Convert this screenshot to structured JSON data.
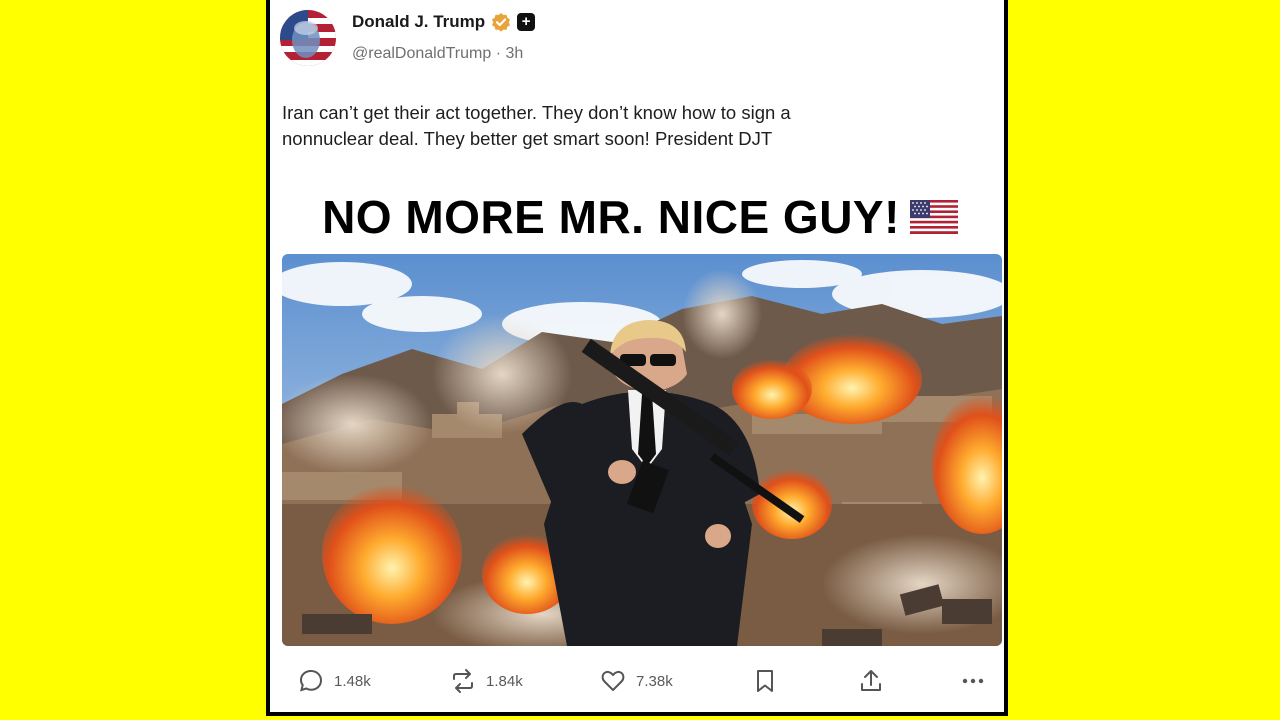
{
  "post": {
    "author": {
      "display_name": "Donald J. Trump",
      "handle": "@realDonaldTrump",
      "separator": "·",
      "time": "3h",
      "badges": [
        "verified-badge-icon",
        "plus-badge-icon"
      ]
    },
    "text_line1": "Iran can’t get their act together. They don’t know how to sign a",
    "text_line2": "nonnuclear deal. They better get smart soon! President DJT",
    "image": {
      "headline": "NO MORE MR. NICE GUY!",
      "headline_emoji": "us-flag-icon",
      "scene": "image-photo"
    },
    "actions": {
      "replies": "1.48k",
      "reposts": "1.84k",
      "likes": "7.38k",
      "icons": [
        "reply-icon",
        "repost-icon",
        "like-icon",
        "bookmark-icon",
        "share-icon",
        "more-icon"
      ]
    }
  },
  "colors": {
    "background": "#FFFF00",
    "card": "#FFFFFF",
    "verified": "#E8A33A",
    "text": "#1E1E1E",
    "muted": "#707070"
  }
}
